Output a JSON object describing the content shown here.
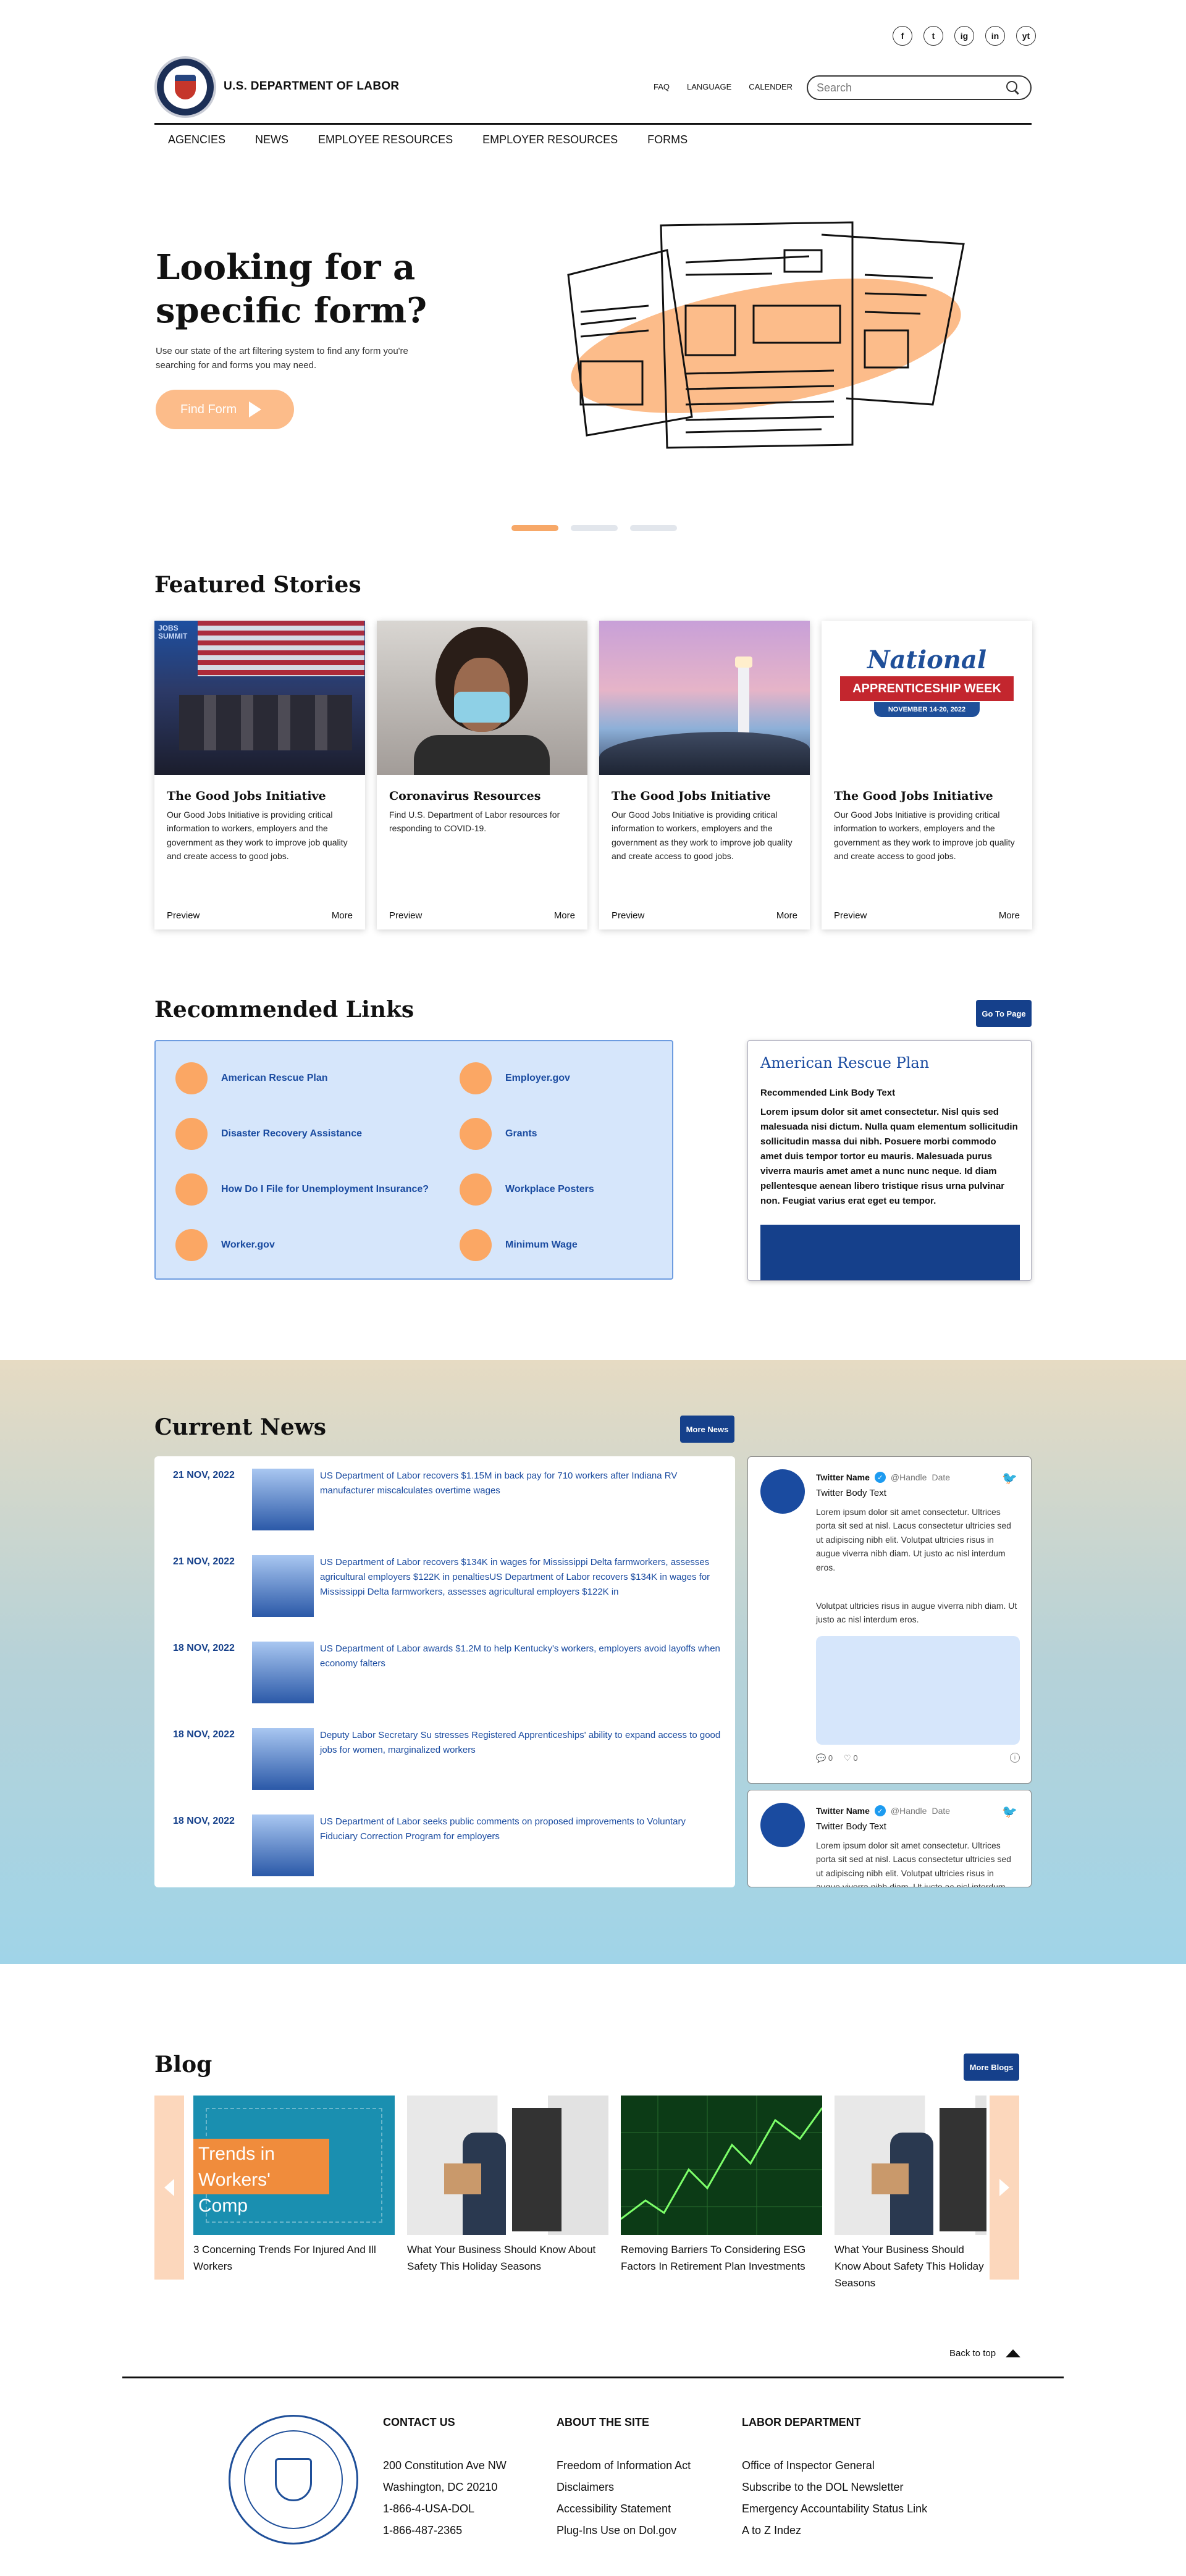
{
  "social": [
    "f",
    "t",
    "ig",
    "in",
    "yt"
  ],
  "header": {
    "dept_name": "U.S. DEPARTMENT OF LABOR",
    "links": [
      "FAQ",
      "LANGUAGE",
      "CALENDER"
    ],
    "search_placeholder": "Search"
  },
  "nav": [
    "AGENCIES",
    "NEWS",
    "EMPLOYEE RESOURCES",
    "EMPLOYER RESOURCES",
    "FORMS"
  ],
  "hero": {
    "title": "Looking for a specific form?",
    "subtitle": "Use our state of the art filtering system to find any form you're searching for and forms you may need.",
    "button": "Find Form"
  },
  "featured": {
    "title": "Featured Stories",
    "cards": [
      {
        "title": "The Good Jobs Initiative",
        "text": "Our Good Jobs Initiative is providing critical information to workers, employers and the government as they work to improve job quality and create access to good jobs.",
        "preview": "Preview",
        "more": "More",
        "image_text": "JOBS SUMMIT"
      },
      {
        "title": "Coronavirus Resources",
        "text": "Find U.S. Department of Labor resources for responding to COVID-19.",
        "preview": "Preview",
        "more": "More"
      },
      {
        "title": "The Good Jobs Initiative",
        "text": "Our Good Jobs Initiative is providing critical information to workers, employers and the government as they work to improve job quality and create access to good jobs.",
        "preview": "Preview",
        "more": "More"
      },
      {
        "title": "The Good Jobs Initiative",
        "text": "Our Good Jobs Initiative is providing critical information to workers, employers and the government as they work to improve job quality and create access to good jobs.",
        "preview": "Preview",
        "more": "More",
        "image_text": {
          "line1": "National",
          "line2": "APPRENTICESHIP WEEK",
          "line3": "NOVEMBER 14-20, 2022"
        }
      }
    ]
  },
  "recommended": {
    "title": "Recommended Links",
    "button": "Go To Page",
    "links": [
      "American Rescue Plan",
      "Employer.gov",
      "Disaster Recovery Assistance",
      "Grants",
      "How Do I File for Unemployment Insurance?",
      "Workplace Posters",
      "Worker.gov",
      "Minimum Wage"
    ],
    "card": {
      "title": "American Rescue Plan",
      "label": "Recommended Link Body Text",
      "body": "Lorem ipsum dolor sit amet consectetur. Nisl quis sed malesuada nisi dictum. Nulla quam elementum sollicitudin sollicitudin massa dui nibh. Posuere morbi commodo amet duis tempor tortor eu mauris. Malesuada purus viverra mauris amet amet a nunc nunc neque. Id diam pellentesque aenean libero tristique risus urna pulvinar non. Feugiat varius erat eget eu tempor."
    }
  },
  "news": {
    "title": "Current News",
    "button": "More News",
    "items": [
      {
        "date": "21 NOV, 2022",
        "title": "US Department of Labor recovers $1.15M in back pay for 710 workers after Indiana RV manufacturer miscalculates overtime wages"
      },
      {
        "date": "21 NOV, 2022",
        "title": "US Department of Labor recovers $134K in wages for Mississippi Delta farmworkers, assesses agricultural employers $122K in penaltiesUS Department of Labor recovers $134K in wages for Mississippi Delta farmworkers, assesses agricultural employers $122K in"
      },
      {
        "date": "18 NOV, 2022",
        "title": "US Department of Labor awards $1.2M to help Kentucky's workers, employers avoid layoffs when economy falters"
      },
      {
        "date": "18 NOV, 2022",
        "title": "Deputy Labor Secretary Su stresses Registered Apprenticeships' ability to expand access to good jobs for women, marginalized workers"
      },
      {
        "date": "18 NOV, 2022",
        "title": "US Department of Labor seeks public comments on proposed improvements to Voluntary Fiduciary Correction Program for employers"
      }
    ],
    "tweets": [
      {
        "name": "Twitter Name",
        "handle": "@Handle",
        "date": "Date",
        "body_label": "Twitter Body Text",
        "text": "Lorem ipsum dolor sit amet consectetur. Ultrices porta sit sed at nisl. Lacus consectetur ultricies sed ut adipiscing nibh elit. Volutpat ultricies risus in augue viverra nibh diam. Ut justo ac nisl interdum eros.",
        "text2": "Volutpat ultricies risus in augue viverra nibh diam. Ut justo ac nisl interdum eros.",
        "likes": "0",
        "replies": "0"
      },
      {
        "name": "Twitter Name",
        "handle": "@Handle",
        "date": "Date",
        "body_label": "Twitter Body Text",
        "text": "Lorem ipsum dolor sit amet consectetur. Ultrices porta sit sed at nisl. Lacus consectetur ultricies sed ut adipiscing nibh elit. Volutpat ultricies risus in augue viverra nibh diam. Ut justo ac nisl interdum eros."
      }
    ]
  },
  "blog": {
    "title": "Blog",
    "button": "More Blogs",
    "items": [
      {
        "title": "3 Concerning Trends For Injured And Ill Workers",
        "image_text": "Trends in Workers' Comp"
      },
      {
        "title": "What Your Business Should Know About Safety This Holiday Seasons"
      },
      {
        "title": "Removing Barriers To Considering ESG Factors In Retirement Plan Investments"
      },
      {
        "title": "What Your Business Should Know About Safety This Holiday Seasons"
      }
    ]
  },
  "back_to_top": "Back to top",
  "footer": {
    "contact": {
      "title": "CONTACT US",
      "lines": [
        "200 Constitution Ave NW",
        "Washington, DC 20210",
        "1-866-4-USA-DOL",
        "1-866-487-2365"
      ]
    },
    "about": {
      "title": "ABOUT THE SITE",
      "lines": [
        "Freedom of Information Act",
        "Disclaimers",
        "Accessibility Statement",
        "Plug-Ins Use on Dol.gov"
      ]
    },
    "labor": {
      "title": "LABOR DEPARTMENT",
      "lines": [
        "Office of Inspector General",
        "Subscribe to the DOL Newsletter",
        "Emergency Accountability Status Link",
        "A to Z Indez"
      ]
    }
  },
  "colors": {
    "navy": "#15408b",
    "orange": "#fba764",
    "light_blue": "#d6e6fb"
  }
}
